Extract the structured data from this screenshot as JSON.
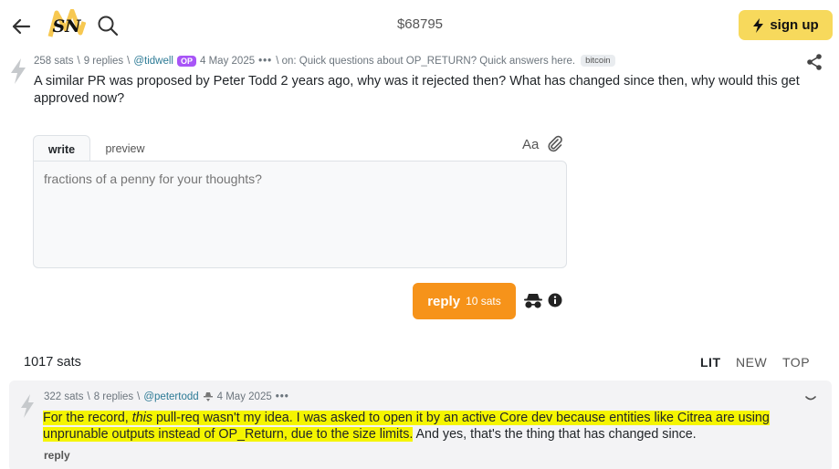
{
  "nav": {
    "back_icon": "arrow-left-icon",
    "logo_text": "SN",
    "search_icon": "search-icon",
    "price": "$68795",
    "signup_label": "sign up",
    "signup_color": "#f7d95c"
  },
  "post": {
    "sats": "258 sats",
    "replies": "9 replies",
    "author": "@tidwell",
    "op_badge": "OP",
    "date": "4 May 2025",
    "dots": "•••",
    "on_label": "\\ on: Quick questions about OP_RETURN? Quick answers here.",
    "sub": "bitcoin",
    "body": "A similar PR was proposed by Peter Todd 2 years ago, why was it rejected then? What has changed since then, why would this get approved now?"
  },
  "editor": {
    "tab_write": "write",
    "tab_preview": "preview",
    "font_toggle": "Aa",
    "placeholder": "fractions of a penny for your thoughts?",
    "reply_label": "reply",
    "reply_cost": "10 sats",
    "reply_color": "#f6931a"
  },
  "comments": {
    "total": "1017 sats",
    "sort": [
      "LIT",
      "NEW",
      "TOP"
    ],
    "items": [
      {
        "sats": "322 sats",
        "replies": "8 replies",
        "author": "@petertodd",
        "date": "4 May 2025",
        "dots": "•••",
        "body_pre": "For the record, ",
        "body_em": "this",
        "body_hl": " pull-req wasn't my idea. I was asked to open it by an active Core dev because entities like Citrea are using unprunable outputs instead of OP_Return, due to the size limits.",
        "body_post": " And yes, that's the thing that has changed since.",
        "reply_label": "reply",
        "highlight_color": "#f5f500"
      }
    ]
  }
}
